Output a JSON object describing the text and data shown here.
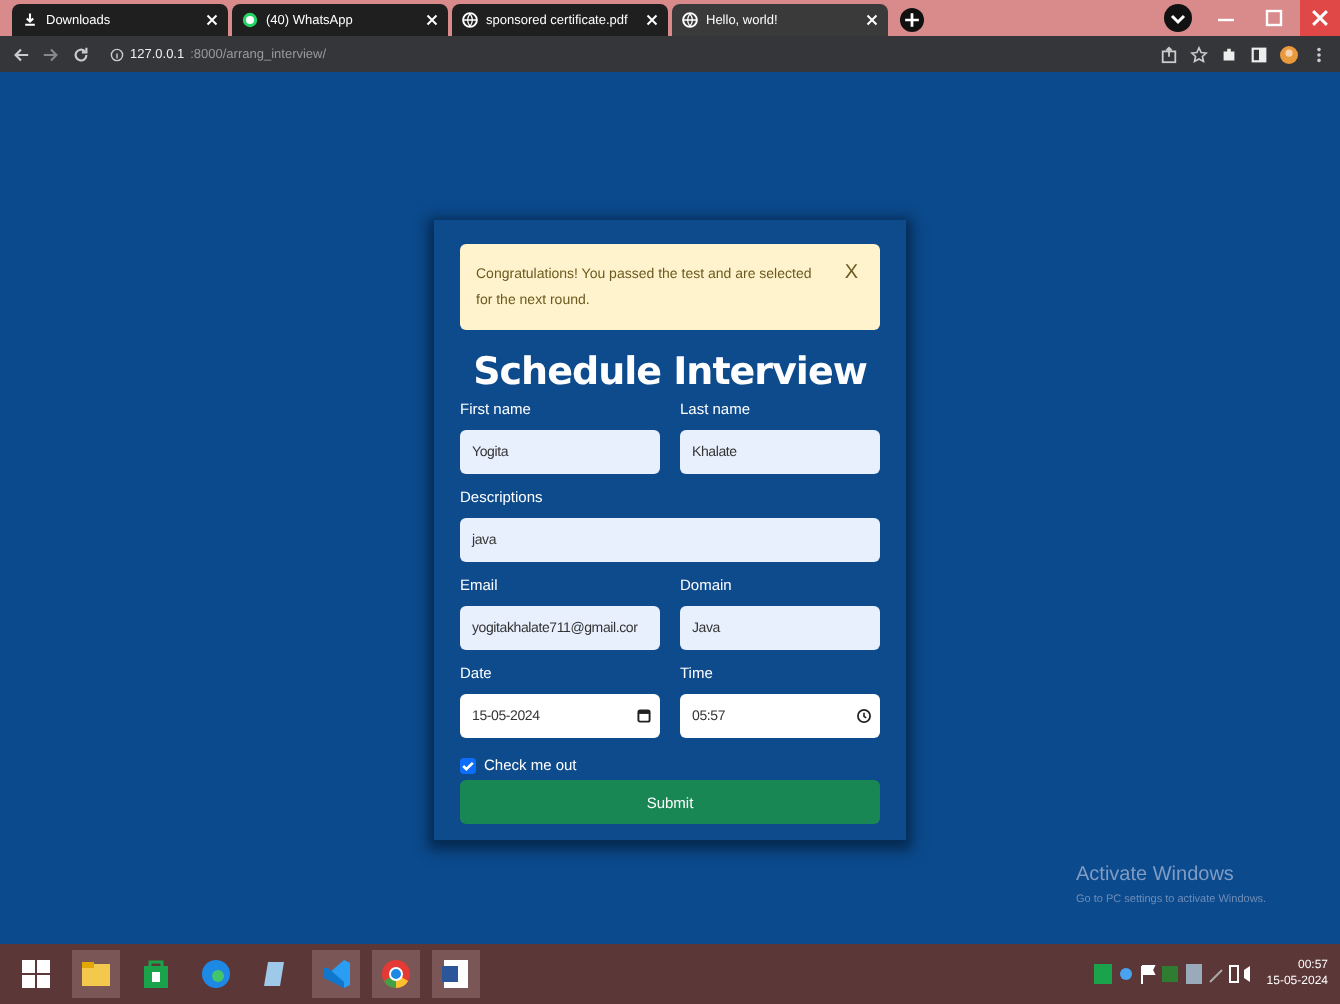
{
  "browser": {
    "tabs": [
      {
        "kind": "download",
        "title": "Downloads",
        "selected": false
      },
      {
        "kind": "chat",
        "title": "(40) WhatsApp",
        "selected": false
      },
      {
        "kind": "globe",
        "title": "sponsored certificate.pdf",
        "selected": false
      },
      {
        "kind": "globe",
        "title": "Hello, world!",
        "selected": true
      }
    ],
    "url_host": "127.0.0.1",
    "url_path": ":8000/arrang_interview/"
  },
  "alert": {
    "message": "Congratulations! You passed the test and are selected for the next round.",
    "close": "X"
  },
  "form": {
    "title": "Schedule Interview",
    "rows": [
      [
        {
          "label": "First name",
          "value": "Yogita",
          "kind": "text"
        },
        {
          "label": "Last name",
          "value": "Khalate",
          "kind": "text"
        }
      ],
      [
        {
          "label": "Descriptions",
          "value": "java",
          "kind": "text"
        }
      ],
      [
        {
          "label": "Email",
          "value": "yogitakhalate711@gmail.cor",
          "kind": "text"
        },
        {
          "label": "Domain",
          "value": "Java",
          "kind": "text"
        }
      ],
      [
        {
          "label": "Date",
          "value": "15-05-2024",
          "kind": "date"
        },
        {
          "label": "Time",
          "value": "05:57",
          "kind": "time"
        }
      ]
    ],
    "checkbox": {
      "label": "Check me out",
      "checked": true
    },
    "submit": "Submit"
  },
  "watermark": {
    "title": "Activate Windows",
    "subtitle": "Go to PC settings to activate Windows."
  },
  "taskbar": {
    "apps": [
      {
        "kind": "start"
      },
      {
        "kind": "folder"
      },
      {
        "kind": "store"
      },
      {
        "kind": "edge"
      },
      {
        "kind": "pad"
      },
      {
        "kind": "code"
      },
      {
        "kind": "chrome"
      },
      {
        "kind": "word"
      }
    ],
    "time": "00:57",
    "date": "15-05-2024"
  }
}
